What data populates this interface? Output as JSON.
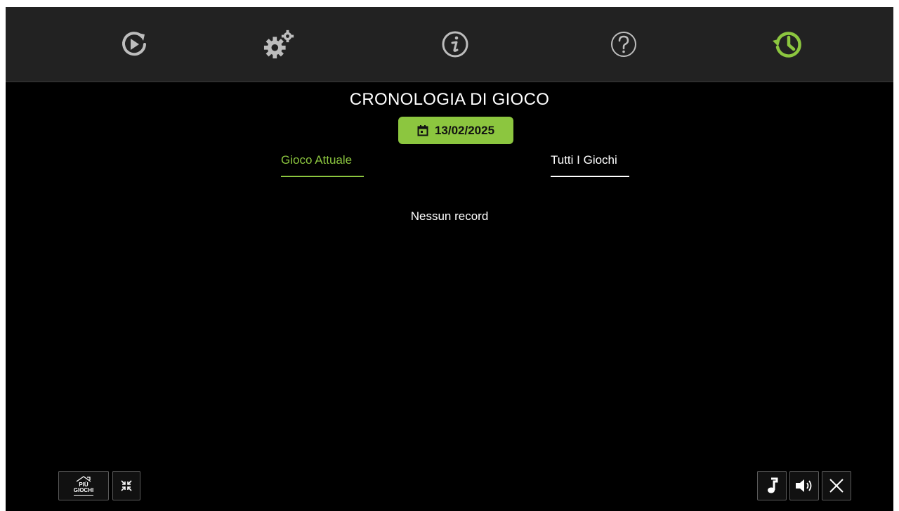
{
  "toolbar": {
    "icons": [
      "restart-icon",
      "settings-icon",
      "info-icon",
      "help-icon",
      "history-icon"
    ],
    "active_color": "#8cc63f"
  },
  "history": {
    "title": "CRONOLOGIA DI GIOCO",
    "date": "13/02/2025",
    "tabs": {
      "current": "Gioco Attuale",
      "all": "Tutti I Giochi"
    },
    "empty_message": "Nessun record"
  },
  "footer": {
    "more_games_line1": "PIÙ",
    "more_games_line2": "GIOCHI",
    "icons": [
      "shrink-icon",
      "music-icon",
      "sound-icon",
      "close-icon"
    ]
  },
  "colors": {
    "accent": "#8cc63f",
    "background": "#000000",
    "topbar": "#222222"
  }
}
